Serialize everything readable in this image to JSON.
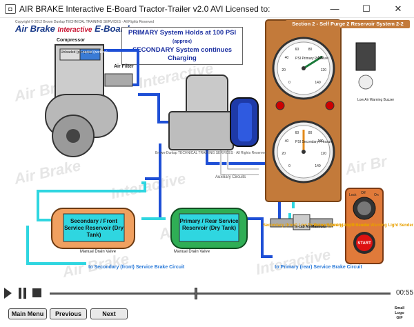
{
  "window": {
    "title": "AIR BRAKE Interactive E-Board Tractor-Trailer  v2.0 AVI    Licensed to:",
    "minimize": "—",
    "maximize": "☐",
    "close": "✕"
  },
  "logo": {
    "part1": "Air Brake",
    "part2": "Interactive",
    "part3": "E-Board"
  },
  "copyright": "Copyright © 2012 Brown Dunlap TECHNICAL TRAINING SERVICES · All Rights Reserved",
  "notice": {
    "line1": "PRIMARY System Holds at 100 PSI",
    "line1_small": "(approx)",
    "line2": "SECONDARY System continues Charging"
  },
  "registered": "Brown-Dunlap TECHNICAL TRAINING SERVICES · All Rights Reserved",
  "panel_header": "Section 2 - Self Purge 2 Reservoir System 2-2",
  "components": {
    "compressor": "Compressor",
    "unloaded": "Unloaded (pumping)",
    "loaded": "Loaded (working)",
    "air_filter": "Air Filter",
    "auxiliary": "Auxiliary Circuits",
    "low_air_buzzer": "Low Air Warning Buzzer",
    "secondary_tank": "Secondary / Front Service Reservoir (Dry Tank)",
    "primary_tank": "Primary / Rear Service Reservoir (Dry Tank)",
    "drain1": "Manual Drain Valve",
    "drain2": "Manual Drain Valve",
    "sec_sender": "Secondary (front) Low Pressure Warning Light Sender",
    "in_cab_manifold": "In-cab Air Manifold",
    "pri_sender": "Primary (rear) Low Pressure Warning Light Sender",
    "to_secondary": "to Secondary (front) Service Brake Circuit",
    "to_primary": "to Primary (rear) Service Brake Circuit"
  },
  "gauges": {
    "upper": {
      "label": "PSI Primary Pressure",
      "ticks": [
        "0",
        "20",
        "40",
        "60",
        "80",
        "100",
        "120",
        "140"
      ],
      "value": 100
    },
    "lower": {
      "label": "PSI Secondary Pressure",
      "ticks": [
        "0",
        "20",
        "40",
        "60",
        "80",
        "100",
        "120",
        "140"
      ],
      "value": 70
    }
  },
  "ignition": {
    "lock": "Lock",
    "off": "Off",
    "on": "On",
    "start": "START"
  },
  "player": {
    "time": "00:55",
    "progress": 0.43
  },
  "nav": {
    "main_menu": "Main Menu",
    "previous": "Previous",
    "next": "Next"
  },
  "small_logo": {
    "line1": "Small",
    "line2": "Logo",
    "line3": "GIF"
  },
  "colors": {
    "primary_line": "#1e4fd6",
    "secondary_line": "#2fd6e0",
    "panel": "#c37a3a",
    "tank_secondary": "#f0a060",
    "tank_primary": "#2fae55"
  }
}
